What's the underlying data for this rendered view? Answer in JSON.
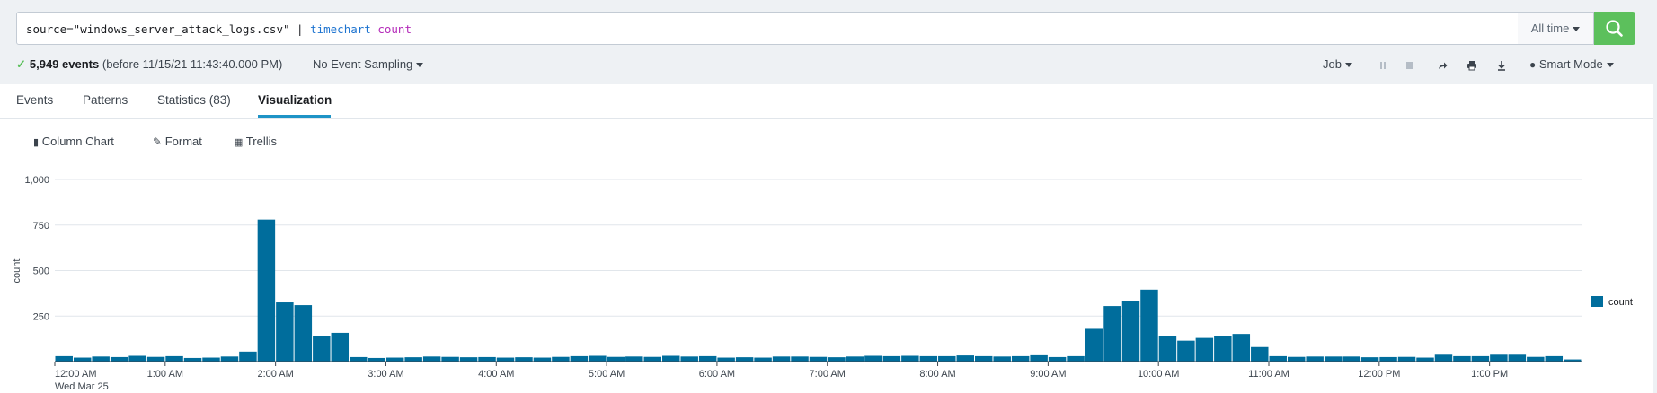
{
  "search": {
    "query_source": "source=\"windows_server_attack_logs.csv\" | ",
    "query_command": "timechart",
    "query_function": "count",
    "time_range": "All time"
  },
  "status": {
    "events_count": "5,949 events",
    "events_detail": "(before 11/15/21 11:43:40.000 PM)",
    "sampling": "No Event Sampling",
    "job_label": "Job",
    "mode_label": "Smart Mode"
  },
  "tabs": [
    {
      "label": "Events"
    },
    {
      "label": "Patterns"
    },
    {
      "label": "Statistics (83)"
    },
    {
      "label": "Visualization"
    }
  ],
  "viz_toolbar": {
    "chart_type": "Column Chart",
    "format": "Format",
    "trellis": "Trellis"
  },
  "colors": {
    "accent": "#1e93c6",
    "bar": "#006d9c",
    "search_button": "#5cc05c"
  },
  "chart_data": {
    "type": "bar",
    "ylabel": "count",
    "ylim": [
      0,
      1000
    ],
    "yticks": [
      "1,000",
      "750",
      "500",
      "250"
    ],
    "series": [
      {
        "name": "count",
        "values": [
          30,
          22,
          28,
          25,
          32,
          26,
          30,
          20,
          22,
          28,
          55,
          780,
          325,
          310,
          138,
          158,
          25,
          20,
          22,
          24,
          28,
          26,
          24,
          25,
          22,
          24,
          22,
          26,
          30,
          32,
          26,
          28,
          26,
          32,
          28,
          30,
          22,
          24,
          22,
          28,
          28,
          26,
          24,
          28,
          32,
          30,
          32,
          30,
          30,
          34,
          30,
          28,
          30,
          35,
          25,
          30,
          180,
          305,
          335,
          395,
          140,
          115,
          130,
          138,
          152,
          80,
          30,
          26,
          28,
          28,
          28,
          24,
          25,
          26,
          22,
          38,
          30,
          30,
          38,
          38,
          26,
          30,
          12
        ]
      }
    ],
    "xtick_labels": [
      "12:00 AM",
      "1:00 AM",
      "2:00 AM",
      "3:00 AM",
      "4:00 AM",
      "5:00 AM",
      "6:00 AM",
      "7:00 AM",
      "8:00 AM",
      "9:00 AM",
      "10:00 AM",
      "11:00 AM",
      "12:00 PM",
      "1:00 PM"
    ],
    "x_date_label": "Wed Mar 25",
    "legend_position": "right",
    "grid": true
  }
}
